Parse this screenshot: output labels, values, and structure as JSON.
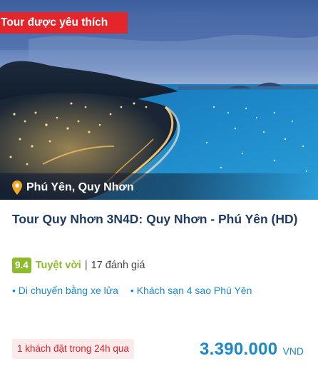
{
  "card": {
    "badge": "Tour được yêu thích",
    "location": "Phú Yên, Quy Nhơn",
    "title": "Tour Quy Nhơn 3N4D: Quy Nhơn - Phú Yên (HD)",
    "rating": {
      "score": "9.4",
      "verdict": "Tuyệt vời",
      "separator": "|",
      "reviews": "17 đánh giá"
    },
    "features": [
      "• Di chuyển bằng xe lửa",
      "• Khách sạn 4 sao Phú Yên"
    ],
    "booked_note": "1 khách đặt trong 24h qua",
    "price": "3.390.000",
    "currency": "VND"
  },
  "icons": {
    "location": "map-pin-icon"
  },
  "colors": {
    "badge_red": "#e3252c",
    "title_navy": "#1f3b63",
    "rating_green": "#8dbb2d",
    "link_blue": "#1a88c9",
    "pin_orange": "#f5a623",
    "booked_bg": "#fdeaea",
    "booked_text": "#d8232a"
  }
}
